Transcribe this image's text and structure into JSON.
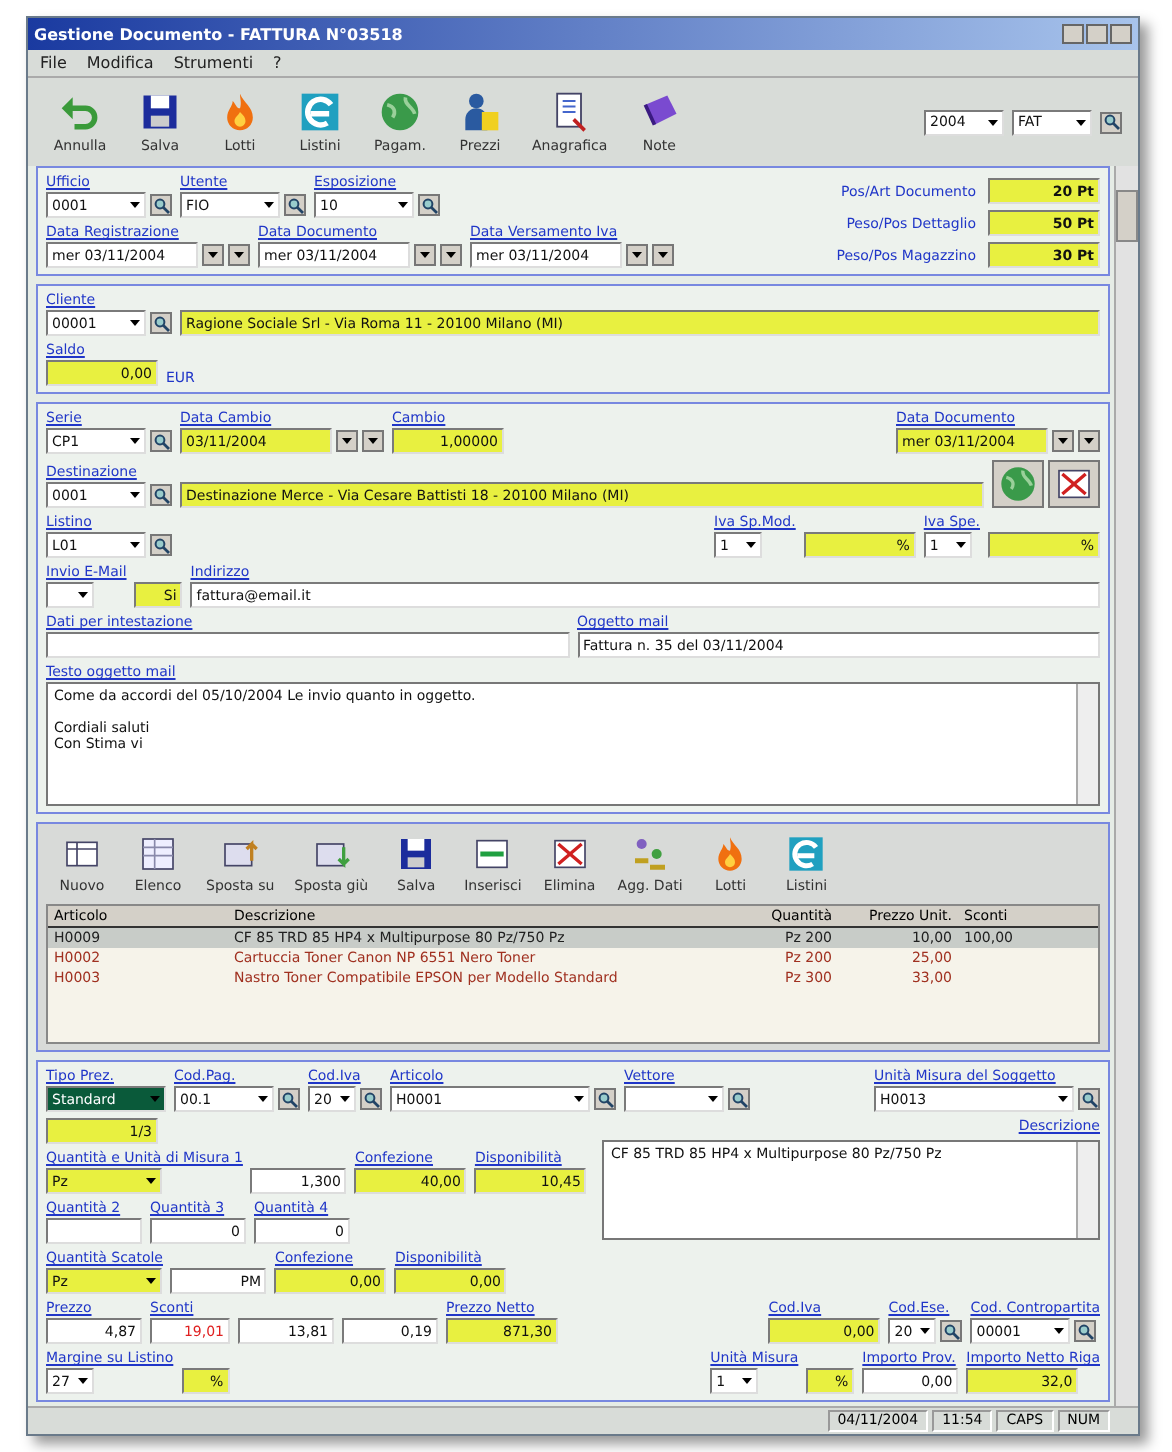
{
  "window": {
    "title": "Gestione Documento - FATTURA N°03518"
  },
  "menu": [
    "File",
    "Modifica",
    "Strumenti",
    "?"
  ],
  "toolbar": [
    {
      "label": "Annulla",
      "kind": "undo"
    },
    {
      "label": "Salva",
      "kind": "save"
    },
    {
      "label": "Lotti",
      "kind": "flame"
    },
    {
      "label": "Listini",
      "kind": "swirl"
    },
    {
      "label": "Pagam.",
      "kind": "globe"
    },
    {
      "label": "Prezzi",
      "kind": "figure"
    },
    {
      "label": "Anagrafica",
      "kind": "document"
    },
    {
      "label": "Note",
      "kind": "book"
    }
  ],
  "year_selects": [
    "2004",
    "FAT"
  ],
  "header": {
    "rows": [
      {
        "fields": [
          {
            "label": "Ufficio",
            "value": "0001",
            "kind": "combo",
            "lookup": true
          },
          {
            "label": "Utente",
            "value": "FIO",
            "kind": "combo",
            "lookup": true
          },
          {
            "label": "Esposizione",
            "value": "10",
            "kind": "combo",
            "lookup": true
          }
        ]
      },
      {
        "fields": [
          {
            "label": "Data Registrazione",
            "value": "mer 03/11/2004",
            "kind": "date"
          },
          {
            "label": "Data Documento",
            "value": "mer 03/11/2004",
            "kind": "date"
          },
          {
            "label": "Data Versamento Iva",
            "value": "mer 03/11/2004",
            "kind": "date"
          }
        ]
      }
    ],
    "totals": [
      {
        "label": "Pos/Art Documento",
        "value": "20 Pt"
      },
      {
        "label": "Peso/Pos Dettaglio",
        "value": "50 Pt"
      },
      {
        "label": "Peso/Pos Magazzino",
        "value": "30 Pt"
      }
    ]
  },
  "customer": {
    "rows": [
      {
        "fields": [
          {
            "label": "Cliente",
            "value": "00001",
            "kind": "combo",
            "lookup": true
          },
          {
            "value": "Ragione Sociale Srl - Via Roma 11 - 20100 Milano (MI)",
            "kind": "yellowwide"
          }
        ]
      },
      {
        "fields": [
          {
            "label": "Saldo",
            "value": "0,00",
            "kind": "yellow"
          },
          {
            "value": "EUR",
            "kind": "note"
          }
        ]
      }
    ]
  },
  "document": {
    "rows": [
      {
        "fields": [
          {
            "label": "Serie",
            "value": "CP1",
            "kind": "combo",
            "lookup": true
          },
          {
            "label": "Data Cambio",
            "value": "03/11/2004",
            "kind": "ydate"
          },
          {
            "label": "Cambio",
            "value": "1,00000",
            "kind": "yellow"
          }
        ],
        "right": [
          {
            "label": "Data Documento",
            "value": "mer 03/11/2004",
            "kind": "ydate"
          }
        ]
      },
      {
        "fields": [
          {
            "label": "Destinazione",
            "value": "0001",
            "kind": "combo",
            "lookup": true
          },
          {
            "value": "Destinazione Merce - Via Cesare Battisti 18 - 20100 Milano (MI)",
            "kind": "yellowwide"
          },
          {
            "kind": "actions"
          }
        ]
      },
      {
        "fields": [
          {
            "label": "Listino",
            "value": "L01",
            "kind": "combo",
            "lookup": true
          }
        ],
        "right": [
          {
            "label": "Iva Sp.Mod.",
            "value": "1",
            "kind": "shortcombo"
          },
          {
            "value": "%",
            "kind": "yellow"
          },
          {
            "label": "Iva Spe.",
            "value": "1",
            "kind": "shortcombo"
          },
          {
            "value": "%",
            "kind": "yellow"
          }
        ]
      },
      {
        "fields": [
          {
            "label": "Invio E-Mail",
            "kind": "shortcombo"
          },
          {
            "value": "Si",
            "kind": "ysmall"
          },
          {
            "label": "Indirizzo",
            "value": "fattura@email.it",
            "kind": "text"
          }
        ]
      },
      {
        "fields": [
          {
            "label": "Dati per intestazione",
            "kind": "text"
          },
          {
            "label": "Oggetto mail",
            "value": "Fattura n. 35 del 03/11/2004",
            "kind": "text"
          }
        ]
      }
    ],
    "message": {
      "label": "Testo oggetto mail",
      "paragraphs": [
        [
          "Come da accordi del 05/10/2004 Le invio quanto in oggetto."
        ],
        [
          "Cordiali saluti",
          "Con Stima vi"
        ]
      ]
    }
  },
  "grid_toolbar": [
    {
      "label": "Nuovo",
      "kind": "table"
    },
    {
      "label": "Elenco",
      "kind": "sheet"
    },
    {
      "label": "Sposta su",
      "kind": "up"
    },
    {
      "label": "Sposta giù",
      "kind": "down"
    },
    {
      "label": "Salva",
      "kind": "save"
    },
    {
      "label": "Inserisci",
      "kind": "insert"
    },
    {
      "label": "Elimina",
      "kind": "delete"
    },
    {
      "label": "Agg. Dati",
      "kind": "people"
    },
    {
      "label": "Lotti",
      "kind": "flame"
    },
    {
      "label": "Listini",
      "kind": "swirl"
    }
  ],
  "grid": {
    "columns": [
      "Articolo",
      "Descrizione",
      "Quantità",
      "Prezzo Unit.",
      "Sconti"
    ],
    "rows": [
      {
        "code": "H0009",
        "description": "CF 85 TRD 85 HP4 x Multipurpose 80 Pz/750 Pz",
        "quantity": "Pz 200",
        "price": "10,00",
        "discount": "100,00",
        "selected": true,
        "color": "#202020"
      },
      {
        "code": "H0002",
        "description": "Cartuccia Toner Canon NP 6551 Nero Toner",
        "quantity": "Pz 200",
        "price": "25,00",
        "selected": false,
        "color": "#a03020"
      },
      {
        "code": "H0003",
        "description": "Nastro Toner Compatibile EPSON per Modello Standard",
        "quantity": "Pz 300",
        "price": "33,00",
        "selected": false,
        "color": "#a03020"
      }
    ]
  },
  "line": {
    "top": {
      "fields": [
        {
          "label": "Tipo Prez.",
          "value": "Standard",
          "kind": "highlight"
        },
        {
          "label": "Cod.Pag.",
          "value": "00.1",
          "kind": "combo",
          "lookup": true
        },
        {
          "label": "Cod.Iva",
          "value": "20",
          "kind": "shortcombo",
          "lookup": true
        },
        {
          "label": "Articolo",
          "value": "H0001",
          "kind": "longcombo",
          "lookup": true
        },
        {
          "label": "Vettore",
          "kind": "combo",
          "lookup": true
        }
      ],
      "right": [
        {
          "label": "Unità Misura del Soggetto",
          "value": "H0013",
          "kind": "longcombo",
          "lookup": true
        }
      ]
    },
    "left_rows": [
      {
        "fields": [
          {
            "value": "1/3",
            "kind": "yellow"
          }
        ]
      },
      {
        "fields": [
          {
            "label": "Quantità e Unità di Misura 1",
            "value": "Pz",
            "kind": "ycombo"
          },
          {
            "value": "1,300",
            "kind": "number"
          },
          {
            "label": "Confezione",
            "value": "40,00",
            "kind": "yellow"
          },
          {
            "label": "Disponibilità",
            "value": "10,45",
            "kind": "yellow"
          }
        ]
      },
      {
        "fields": [
          {
            "label": "Quantità 2",
            "kind": "number"
          },
          {
            "label": "Quantità 3",
            "value": "0",
            "kind": "number"
          },
          {
            "label": "Quantità 4",
            "value": "0",
            "kind": "number"
          }
        ]
      },
      {
        "fields": [
          {
            "label": "Quantità Scatole",
            "value": "Pz",
            "kind": "ycombo"
          },
          {
            "value": "PM",
            "kind": "number"
          },
          {
            "label": "Confezione",
            "value": "0,00",
            "kind": "yellow"
          },
          {
            "label": "Disponibilità",
            "value": "0,00",
            "kind": "yellow"
          }
        ]
      }
    ],
    "description": {
      "label": "Descrizione",
      "text": "CF 85 TRD 85 HP4 x Multipurpose 80 Pz/750 Pz"
    },
    "bottom_rows": [
      {
        "fields": [
          {
            "label": "Prezzo",
            "value": "4,87",
            "kind": "number"
          },
          {
            "label": "Sconti",
            "value": "19,01",
            "kind": "rednumber"
          },
          {
            "value": "13,81",
            "kind": "number"
          },
          {
            "value": "0,19",
            "kind": "number"
          },
          {
            "label": "Prezzo Netto",
            "value": "871,30",
            "kind": "yellow"
          }
        ],
        "right": [
          {
            "label": "Cod.Iva",
            "value": "0,00",
            "kind": "yellow"
          },
          {
            "label": "Cod.Ese.",
            "value": "20",
            "kind": "shortcombo",
            "lookup": true
          },
          {
            "label": "Cod. Contropartita",
            "value": "00001",
            "kind": "combo",
            "lookup": true
          }
        ]
      },
      {
        "fields": [
          {
            "label": "Margine su Listino",
            "value": "27",
            "kind": "shortcombo"
          },
          {
            "value": "%",
            "kind": "ysmall"
          }
        ],
        "right": [
          {
            "label": "Unità Misura",
            "value": "1",
            "kind": "shortcombo"
          },
          {
            "value": "%",
            "kind": "ysmall"
          },
          {
            "label": "Importo Prov.",
            "value": "0,00",
            "kind": "number"
          },
          {
            "label": "Importo Netto Riga",
            "value": "32,0",
            "kind": "yellow"
          }
        ]
      }
    ]
  },
  "status_bar": [
    "04/11/2004",
    "11:54",
    "CAPS",
    "NUM"
  ]
}
